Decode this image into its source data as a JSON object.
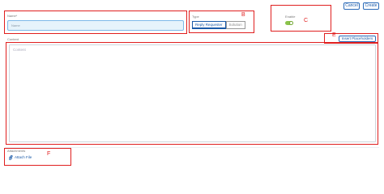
{
  "header": {
    "cancel_label": "Cancel",
    "create_label": "Create"
  },
  "form": {
    "name_label": "Name*",
    "name_placeholder": "Name",
    "type_label": "Type",
    "type_options": [
      "Reply Requester",
      "Solution"
    ],
    "type_selected": "Reply Requester",
    "enable_label": "Enable",
    "enable_on": true,
    "content_label": "Content",
    "content_placeholder": "Content",
    "insert_placeholders_label": "Insert Placeholders",
    "attachments_label": "Attachments",
    "attach_file_label": "Attach File"
  },
  "annotations": {
    "a": "A",
    "b": "B",
    "c": "C",
    "d": "D",
    "e": "E",
    "f": "F"
  },
  "colors": {
    "annotation": "#e01f1f",
    "accent": "#1a5aa8",
    "toggle_on": "#8bc34a",
    "name_field_bg": "#e6f3fb"
  }
}
